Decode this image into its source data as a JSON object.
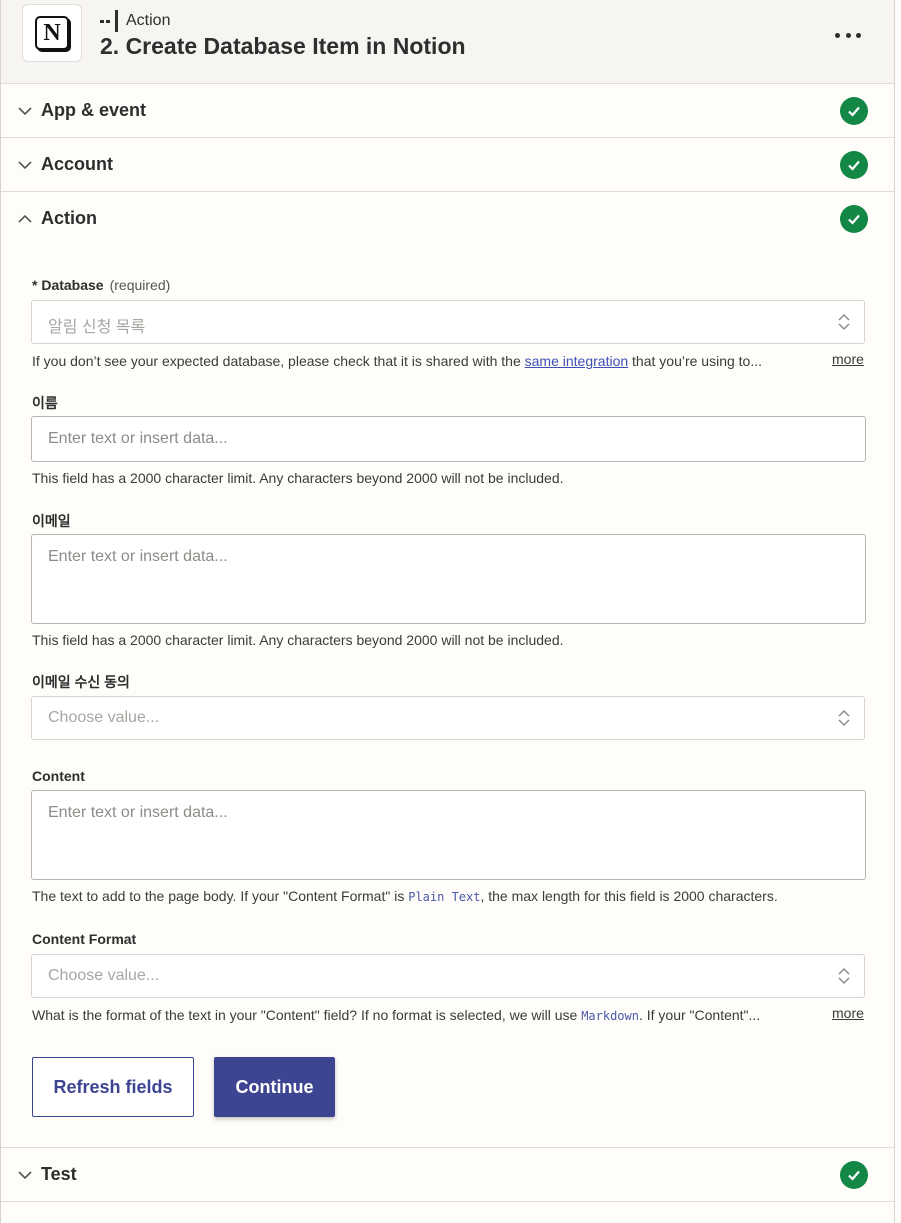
{
  "header": {
    "step_kind": "Action",
    "step_title": "2. Create Database Item in Notion",
    "app_logo_letter": "N"
  },
  "sections": {
    "app_event": "App & event",
    "account": "Account",
    "action": "Action",
    "test": "Test"
  },
  "form": {
    "database": {
      "label": "* Database",
      "required": "(required)",
      "value": "알림 신청 목록",
      "help_before": "If you don’t see your expected database, please check that it is shared with the ",
      "help_link": "same integration",
      "help_after": " that you’re using to...",
      "more": "more"
    },
    "name": {
      "label": "이름",
      "placeholder": "Enter text or insert data...",
      "help": "This field has a 2000 character limit. Any characters beyond 2000 will not be included."
    },
    "email": {
      "label": "이메일",
      "placeholder": "Enter text or insert data...",
      "help": "This field has a 2000 character limit. Any characters beyond 2000 will not be included."
    },
    "consent": {
      "label": "이메일 수신 동의",
      "placeholder": "Choose value..."
    },
    "content": {
      "label": "Content",
      "placeholder": "Enter text or insert data...",
      "help_before": "The text to add to the page body. If your \"Content Format\" is ",
      "help_code": "Plain Text",
      "help_after": ", the max length for this field is 2000 characters."
    },
    "content_format": {
      "label": "Content Format",
      "placeholder": "Choose value...",
      "help_before": "What is the format of the text in your \"Content\" field? If no format is selected, we will use ",
      "help_code": "Markdown",
      "help_after": ". If your \"Content\"...",
      "more": "more"
    }
  },
  "buttons": {
    "refresh": "Refresh fields",
    "continue": "Continue"
  },
  "colors": {
    "success": "#128746",
    "primary": "#3d4592"
  },
  "icons": [
    "notion-logo",
    "step-kind-icon",
    "more-options-icon",
    "chevron-down-icon",
    "chevron-up-icon",
    "check-circle-icon",
    "updown-chevron-icon"
  ]
}
